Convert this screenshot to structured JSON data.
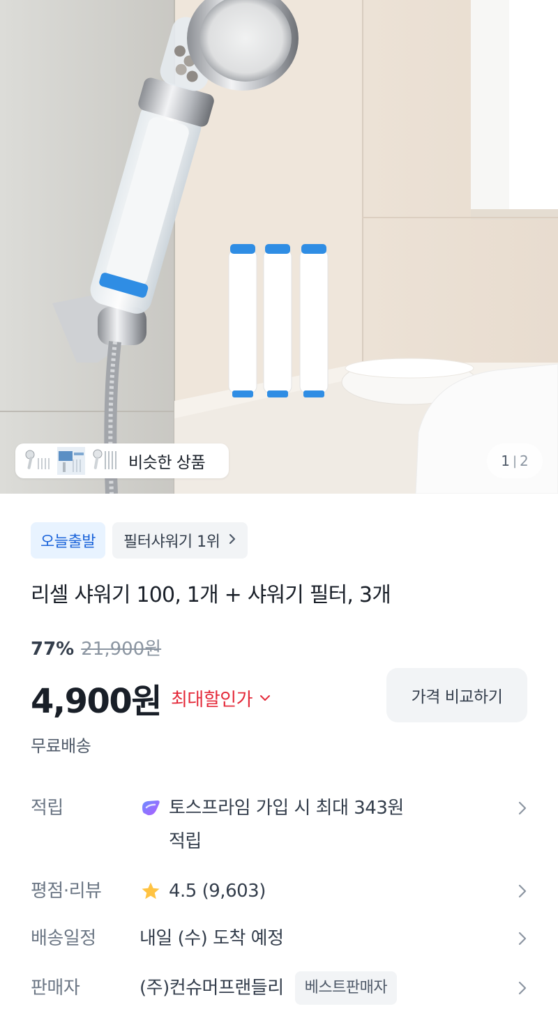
{
  "gallery": {
    "similar_label": "비슷한 상품",
    "current_page": "1",
    "page_separator": "|",
    "total_pages": "2"
  },
  "badges": {
    "departure": "오늘출발",
    "ranking": "필터샤워기 1위"
  },
  "product": {
    "title": "리셀 샤워기 100, 1개 + 샤워기 필터, 3개",
    "discount_rate": "77%",
    "original_price": "21,900원",
    "sale_price": "4,900원",
    "max_discount_label": "최대할인가",
    "compare_button": "가격 비교하기",
    "shipping": "무료배송"
  },
  "details": {
    "points_label": "적립",
    "points_value_line1": "토스프라임 가입 시 최대 343원",
    "points_value_line2": "적립",
    "rating_label": "평점·리뷰",
    "rating_value": "4.5 (9,603)",
    "delivery_label": "배송일정",
    "delivery_value": "내일 (수) 도착 예정",
    "seller_label": "판매자",
    "seller_value": "(주)컨슈머프랜들리",
    "seller_badge": "베스트판매자"
  },
  "colors": {
    "accent_blue": "#1b64da",
    "discount_red": "#e42939",
    "star": "#ffc342"
  }
}
